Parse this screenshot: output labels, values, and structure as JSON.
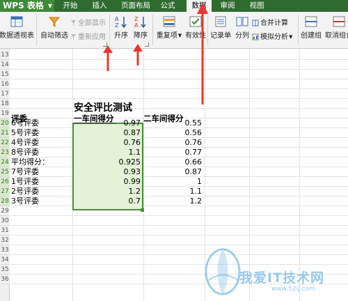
{
  "app": {
    "name": "WPS 表格"
  },
  "menu": {
    "tabs": [
      {
        "label": "开始"
      },
      {
        "label": "插入"
      },
      {
        "label": "页面布局"
      },
      {
        "label": "公式"
      },
      {
        "label": "数据"
      },
      {
        "label": "审阅"
      },
      {
        "label": "视图"
      }
    ],
    "active_tab": "数据"
  },
  "ribbon": {
    "pivot_label": "数据透视表",
    "autofilter_label": "自动筛选",
    "show_all_label": "全部显示",
    "reapply_label": "重新应用",
    "sort_asc_label": "升序",
    "sort_desc_label": "降序",
    "duplicates_label": "重复项",
    "validity_label": "有效性",
    "record_label": "记录单",
    "split_label": "分列",
    "consolidate_label": "合并计算",
    "whatif_label": "模拟分析",
    "group_label": "创建组",
    "ungroup_label": "取消组合"
  },
  "sheet": {
    "row_numbers": [
      "13",
      "14",
      "15",
      "16",
      "17",
      "18",
      "19",
      "20",
      "21",
      "22",
      "23",
      "24",
      "25",
      "26",
      "27",
      "28",
      "29",
      "30",
      "31",
      "32",
      "33",
      "34",
      "35",
      "36"
    ],
    "selected_rows": [
      "20",
      "21",
      "22",
      "23",
      "24",
      "25",
      "26",
      "27",
      "28"
    ],
    "title": "安全评比测试",
    "col_a_header": "评委",
    "col_b_header": "一车间得分",
    "col_c_header": "二车间得分",
    "rows": [
      {
        "judge": "6号评委",
        "b": "0.97",
        "c": "0.55"
      },
      {
        "judge": "5号评委",
        "b": "0.87",
        "c": "0.56"
      },
      {
        "judge": "4号评委",
        "b": "0.76",
        "c": "0.76"
      },
      {
        "judge": "8号评委",
        "b": "1.1",
        "c": "0.77"
      },
      {
        "judge": "平均得分：",
        "b": "0.925",
        "c": "0.66"
      },
      {
        "judge": "7号评委",
        "b": "0.93",
        "c": "0.87"
      },
      {
        "judge": "1号评委",
        "b": "0.99",
        "c": "1"
      },
      {
        "judge": "2号评委",
        "b": "1.2",
        "c": "1.1"
      },
      {
        "judge": "3号评委",
        "b": "0.7",
        "c": "1.2"
      }
    ]
  },
  "watermark": {
    "text": "我爱IT技术网",
    "url": "www.52ij.com"
  },
  "colors": {
    "accent": "#2f6b2f",
    "selection": "#e4f2d8",
    "arrow": "#e8382f",
    "watermark": "#78b9e6"
  }
}
